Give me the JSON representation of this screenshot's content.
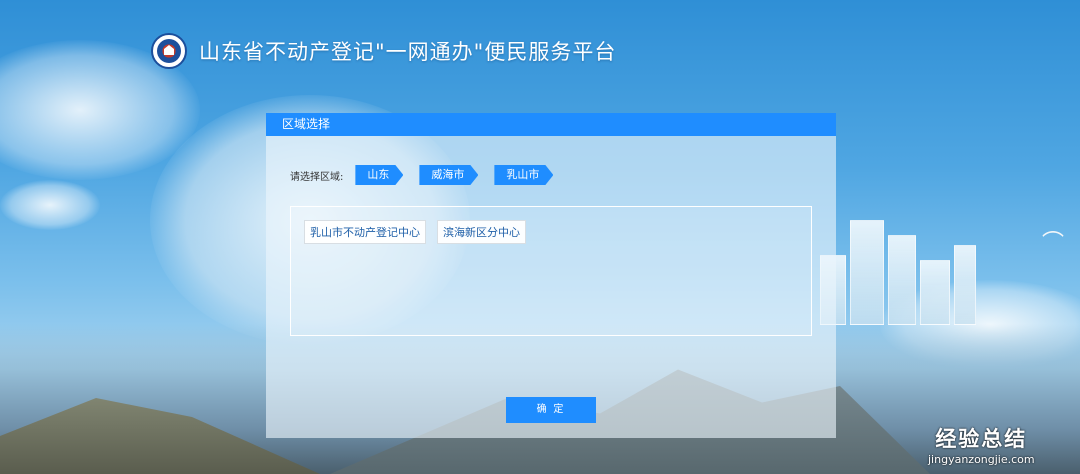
{
  "header": {
    "title": "山东省不动产登记\"一网通办\"便民服务平台",
    "logo_icon": "emblem-icon"
  },
  "panel": {
    "title": "区域选择",
    "region_label": "请选择区域:",
    "breadcrumbs": [
      "山东",
      "威海市",
      "乳山市"
    ],
    "options": [
      "乳山市不动产登记中心",
      "滨海新区分中心"
    ],
    "confirm_label": "确 定"
  },
  "watermark": {
    "main": "经验总结",
    "sub": "jingyanzongjie.com"
  },
  "colors": {
    "accent": "#1f8dff",
    "option_text": "#1e5fa8"
  }
}
